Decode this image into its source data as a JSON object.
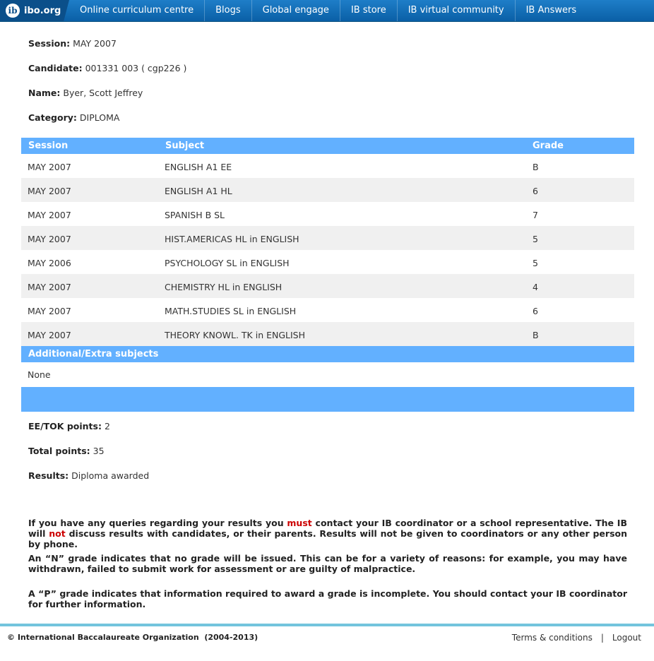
{
  "nav": {
    "brand": "ibo.org",
    "links": [
      "Online curriculum centre",
      "Blogs",
      "Global engage",
      "IB store",
      "IB virtual community",
      "IB Answers"
    ]
  },
  "info": {
    "session_label": "Session:",
    "session_value": "MAY 2007",
    "candidate_label": "Candidate:",
    "candidate_value": "001331 003 ( cgp226 )",
    "name_label": "Name:",
    "name_value": "Byer, Scott Jeffrey",
    "category_label": "Category:",
    "category_value": "DIPLOMA"
  },
  "table": {
    "headers": [
      "Session",
      "Subject",
      "Grade"
    ],
    "rows": [
      {
        "session": "MAY 2007",
        "subject": "ENGLISH A1 EE",
        "grade": "B"
      },
      {
        "session": "MAY 2007",
        "subject": "ENGLISH A1 HL",
        "grade": "6"
      },
      {
        "session": "MAY 2007",
        "subject": "SPANISH B SL",
        "grade": "7"
      },
      {
        "session": "MAY 2007",
        "subject": "HIST.AMERICAS HL in ENGLISH",
        "grade": "5"
      },
      {
        "session": "MAY 2006",
        "subject": "PSYCHOLOGY SL in ENGLISH",
        "grade": "5"
      },
      {
        "session": "MAY 2007",
        "subject": "CHEMISTRY HL in ENGLISH",
        "grade": "4"
      },
      {
        "session": "MAY 2007",
        "subject": "MATH.STUDIES SL in ENGLISH",
        "grade": "6"
      },
      {
        "session": "MAY 2007",
        "subject": "THEORY KNOWL. TK in ENGLISH",
        "grade": "B"
      }
    ],
    "extra_header": "Additional/Extra subjects",
    "extra_value": "None"
  },
  "summary": {
    "eetok_label": "EE/TOK points:",
    "eetok_value": "2",
    "total_label": "Total points:",
    "total_value": "35",
    "results_label": "Results:",
    "results_value": "Diploma awarded"
  },
  "notes": {
    "p1_a": "If you have any queries regarding your results you ",
    "p1_must": "must",
    "p1_b": " contact your IB coordinator or a school representative. The IB will ",
    "p1_not": "not",
    "p1_c": " discuss results with candidates, or their parents. Results will not be given to coordinators or any other person by phone.",
    "p2": "An “N” grade indicates that no grade will be issued. This can be for a variety of reasons: for example, you may have withdrawn, failed to submit work for assessment or are guilty of malpractice.",
    "p3": "A “P” grade indicates that information required to award a grade is incomplete. You should contact your IB coordinator for further information."
  },
  "footer": {
    "copyright": "© International Baccalaureate Organization  (2004-2013)",
    "terms": "Terms & conditions",
    "separator": "|",
    "logout": "Logout"
  },
  "colors": {
    "nav_bg": "#1174c1",
    "table_header": "#62b0ff",
    "footer_line": "#73c4dd",
    "emphasis": "#cc0000"
  }
}
